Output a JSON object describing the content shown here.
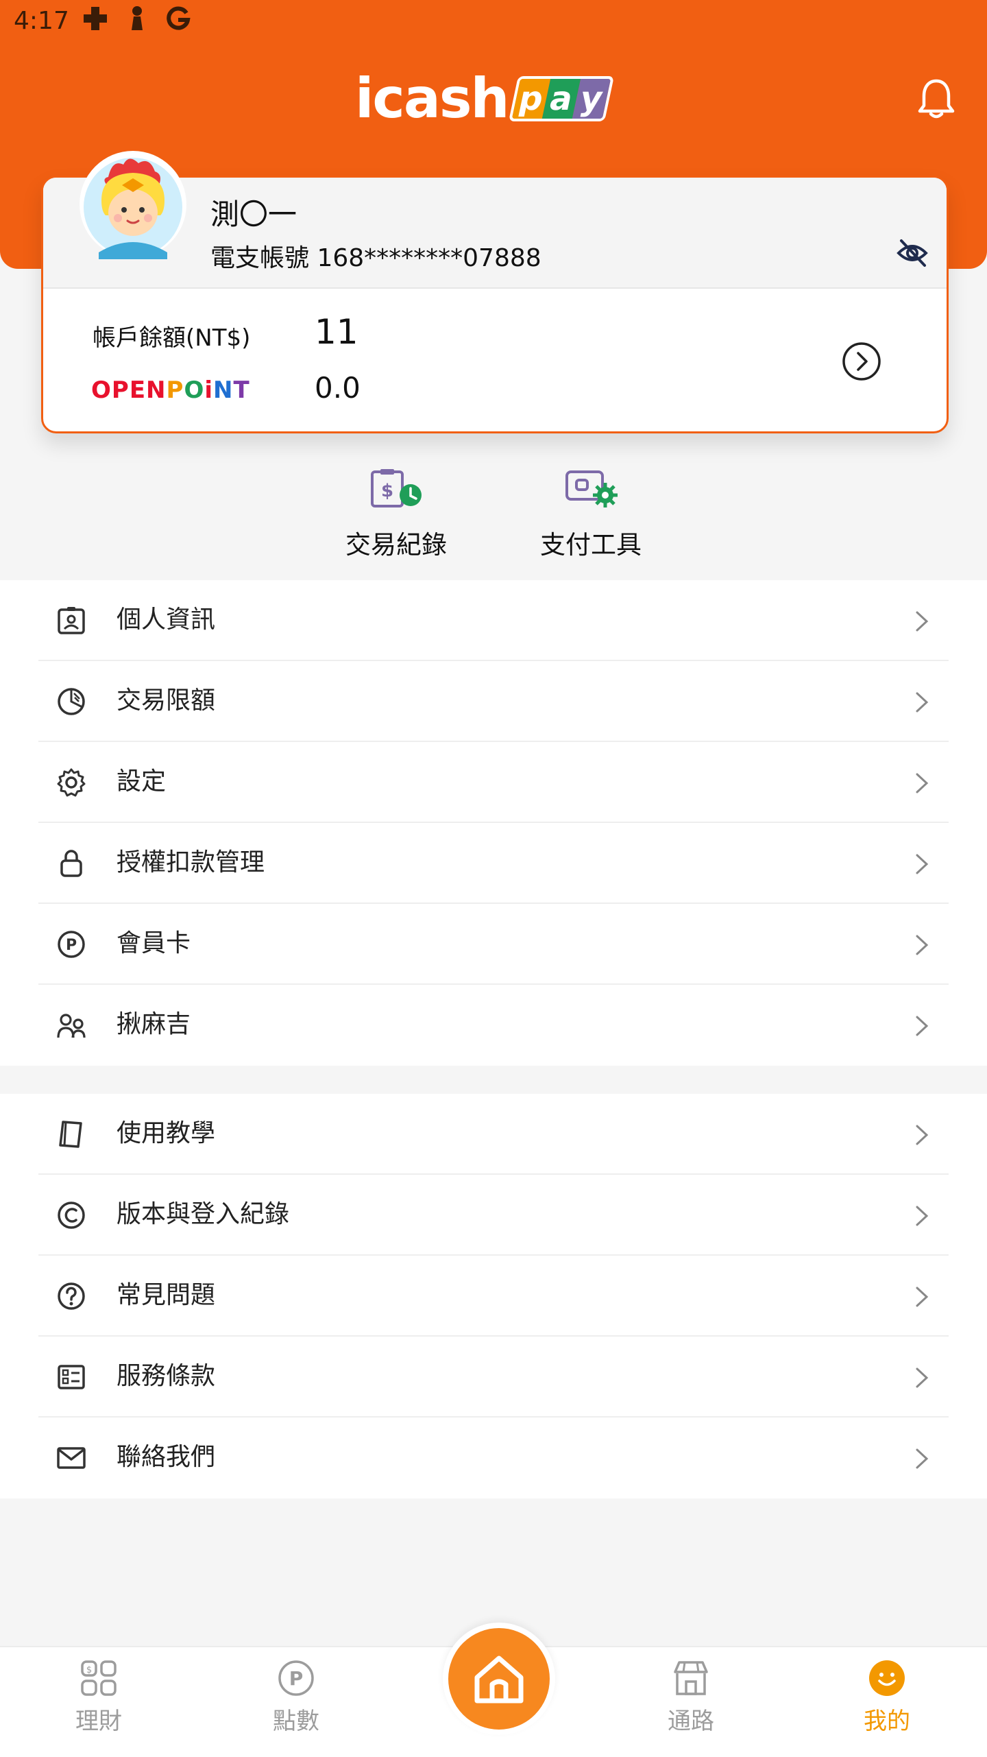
{
  "status_bar": {
    "time": "4:17",
    "icons": [
      "medical-cross-icon",
      "chess-piece-icon",
      "google-icon"
    ]
  },
  "header": {
    "logo_text": "icash",
    "logo_pay": [
      "p",
      "a",
      "y"
    ],
    "brand_color": "#f15f12"
  },
  "account": {
    "name": "測〇一",
    "account_number": "電支帳號 168********07888",
    "balance_label": "帳戶餘額(NT$)",
    "balance_value": "11",
    "points_brand": "OPENPOINT",
    "points_value": "0.0"
  },
  "quick_actions": [
    {
      "label": "交易紀錄",
      "icon": "transaction-record-icon"
    },
    {
      "label": "支付工具",
      "icon": "payment-tool-icon"
    }
  ],
  "menu_group_1": [
    {
      "label": "個人資訊",
      "icon": "id-card-icon"
    },
    {
      "label": "交易限額",
      "icon": "pie-chart-icon"
    },
    {
      "label": "設定",
      "icon": "gear-icon"
    },
    {
      "label": "授權扣款管理",
      "icon": "lock-icon"
    },
    {
      "label": "會員卡",
      "icon": "point-icon"
    },
    {
      "label": "揪麻吉",
      "icon": "friends-icon"
    }
  ],
  "menu_group_2": [
    {
      "label": "使用教學",
      "icon": "book-icon"
    },
    {
      "label": "版本與登入紀錄",
      "icon": "copyright-icon"
    },
    {
      "label": "常見問題",
      "icon": "question-icon"
    },
    {
      "label": "服務條款",
      "icon": "terms-icon"
    },
    {
      "label": "聯絡我們",
      "icon": "mail-icon"
    }
  ],
  "bottom_nav": [
    {
      "label": "理財",
      "icon": "finance-icon",
      "active": false
    },
    {
      "label": "點數",
      "icon": "point-icon",
      "active": false
    },
    {
      "label": "",
      "icon": "home-icon",
      "active": false
    },
    {
      "label": "通路",
      "icon": "store-icon",
      "active": false
    },
    {
      "label": "我的",
      "icon": "smile-icon",
      "active": true
    }
  ],
  "colors": {
    "accent": "#f15f12",
    "home_button": "#f7881f",
    "active_tab": "#f39800",
    "quick_icon_purple": "#7d6aa8",
    "quick_icon_green": "#1f9e58"
  }
}
